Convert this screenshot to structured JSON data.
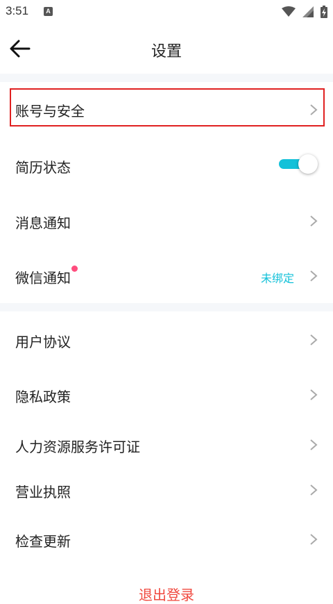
{
  "status_bar": {
    "time": "3:51",
    "app_icon_letter": "A"
  },
  "header": {
    "title": "设置"
  },
  "settings": {
    "account_security": "账号与安全",
    "resume_status": "简历状态",
    "resume_status_on": true,
    "message_notification": "消息通知",
    "wechat_notification": "微信通知",
    "wechat_status": "未绑定",
    "user_agreement": "用户协议",
    "privacy_policy": "隐私政策",
    "hr_license": "人力资源服务许可证",
    "business_license": "营业执照",
    "check_update": "检查更新",
    "logout": "退出登录"
  },
  "colors": {
    "accent": "#13c1d9",
    "highlight_border": "#e02020",
    "logout_text": "#f0483e",
    "badge_dot": "#ff4d7e",
    "section_gap": "#f5f7fa"
  }
}
